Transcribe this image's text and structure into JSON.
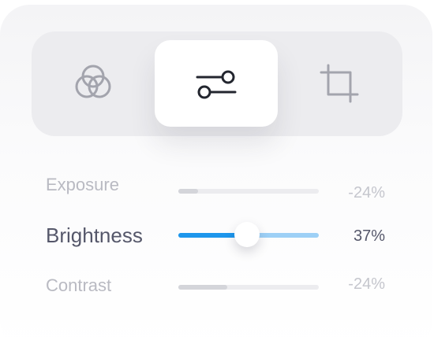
{
  "tabs": [
    {
      "icon": "color-circles-icon",
      "selected": false
    },
    {
      "icon": "sliders-icon",
      "selected": true
    },
    {
      "icon": "crop-icon",
      "selected": false
    }
  ],
  "adjustments": [
    {
      "label": "Exposure",
      "value": "-24%",
      "level": 0.14,
      "active": false
    },
    {
      "label": "Brightness",
      "value": "37%",
      "level": 0.49,
      "active": true
    },
    {
      "label": "Contrast",
      "value": "-24%",
      "level": 0.35,
      "active": false
    }
  ],
  "colors": {
    "accent": "#1d96ec",
    "accent_light": "#9dd0f6",
    "text_active": "#55576a",
    "text_inactive": "#b9bac2"
  }
}
